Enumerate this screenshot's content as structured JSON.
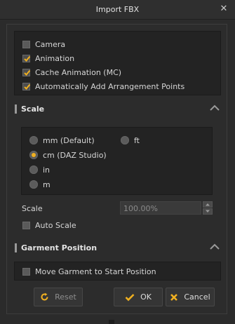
{
  "window": {
    "title": "Import FBX",
    "close_glyph": "✕"
  },
  "options": [
    {
      "label": "Camera",
      "checked": false
    },
    {
      "label": "Animation",
      "checked": true
    },
    {
      "label": "Cache Animation (MC)",
      "checked": true
    },
    {
      "label": "Automatically Add Arrangement Points",
      "checked": true
    }
  ],
  "scale_section": {
    "title": "Scale",
    "units": [
      {
        "label": "mm (Default)",
        "selected": false
      },
      {
        "label": "ft",
        "selected": false
      },
      {
        "label": "cm (DAZ Studio)",
        "selected": true
      },
      {
        "label": "in",
        "selected": false
      },
      {
        "label": "m",
        "selected": false
      }
    ],
    "scale_label": "Scale",
    "scale_value": "100.00%",
    "auto_scale_label": "Auto Scale",
    "auto_scale_checked": false
  },
  "garment_section": {
    "title": "Garment Position",
    "move_label": "Move Garment to Start Position",
    "move_checked": false
  },
  "buttons": {
    "reset": "Reset",
    "ok": "OK",
    "cancel": "Cancel"
  },
  "colors": {
    "accent": "#f0b020",
    "background": "#2b2b2b",
    "panel": "#232323",
    "cancel_icon": "#f0b020"
  },
  "icons": {
    "close": "close-icon",
    "collapse": "chevron-up-icon",
    "reset": "reset-icon",
    "ok": "check-icon",
    "cancel": "x-icon"
  }
}
